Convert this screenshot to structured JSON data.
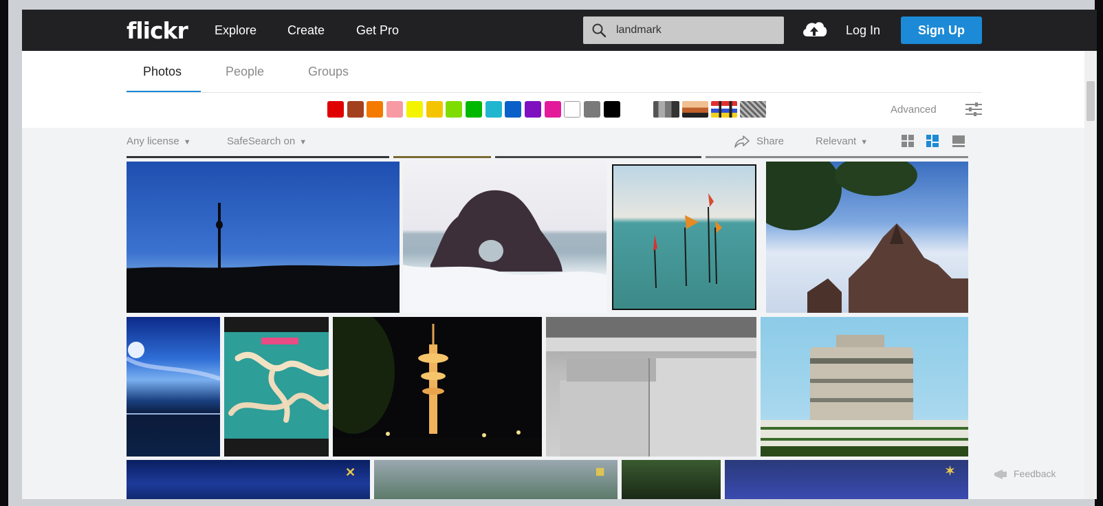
{
  "nav": {
    "logo": "flickr",
    "links": [
      "Explore",
      "Create",
      "Get Pro"
    ],
    "search_query": "landmark",
    "login": "Log In",
    "signup": "Sign Up"
  },
  "tabs": [
    "Photos",
    "People",
    "Groups"
  ],
  "colors": {
    "accent": "#1c8ad6",
    "nav_bg": "#212124",
    "swatches": [
      "#e00000",
      "#a3401e",
      "#f47a00",
      "#f79aa4",
      "#f4f400",
      "#f5c400",
      "#7fdc00",
      "#00b800",
      "#20b6d0",
      "#0a60c8",
      "#7f10c0",
      "#e31b9a",
      "#ffffff",
      "#7a7a7a",
      "#000000"
    ]
  },
  "patterns": [
    "shallow-depth-of-field-pattern",
    "minimalist-pattern",
    "black-and-white-pattern",
    "pattern-pattern"
  ],
  "advanced_label": "Advanced",
  "filters": {
    "license": "Any license",
    "safesearch": "SafeSearch on",
    "share": "Share",
    "sort": "Relevant"
  },
  "view_modes": [
    "grid-small-icon",
    "grid-justified-icon",
    "grid-detail-icon"
  ],
  "feedback": "Feedback"
}
